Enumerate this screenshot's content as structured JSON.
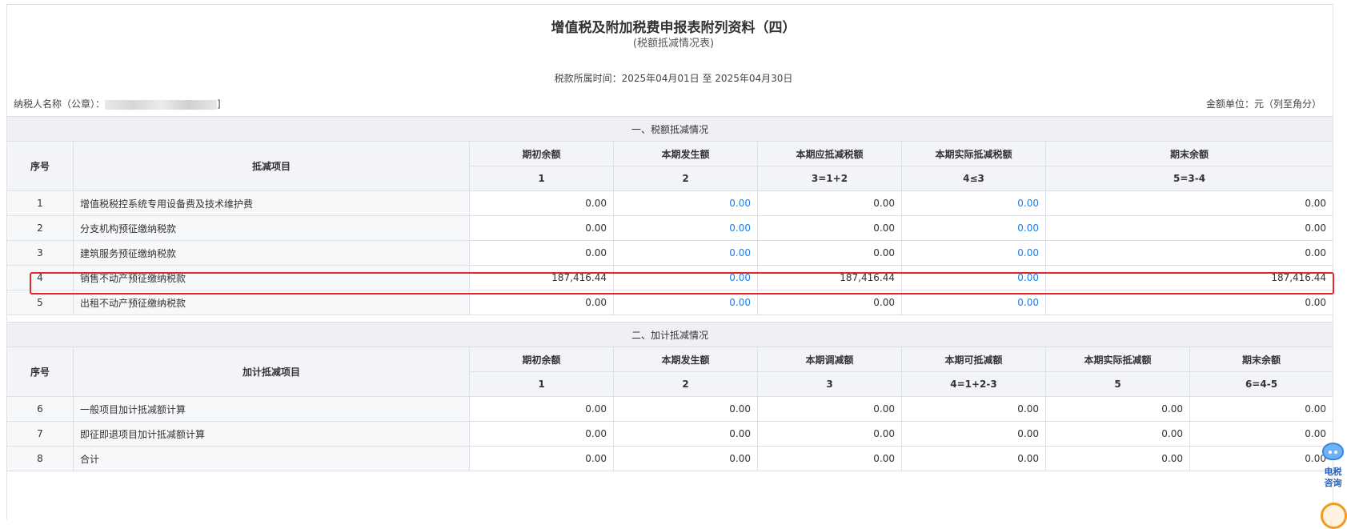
{
  "header": {
    "title": "增值税及附加税费申报表附列资料（四）",
    "subtitle": "(税额抵减情况表)",
    "period": "税款所属时间：2025年04月01日 至 2025年04月30日",
    "taxpayer_label": "纳税人名称（公章）：",
    "taxpayer_suffix": "]",
    "unit": "金额单位：元（列至角分）"
  },
  "section1": {
    "title": "一、税额抵减情况",
    "col_seq": "序号",
    "col_item": "抵减项目",
    "columns": [
      "期初余额",
      "本期发生额",
      "本期应抵减税额",
      "本期实际抵减税额",
      "期末余额"
    ],
    "formulas": [
      "1",
      "2",
      "3=1+2",
      "4≤3",
      "5=3-4"
    ],
    "rows": [
      {
        "seq": "1",
        "item": "增值税税控系统专用设备费及技术维护费",
        "values": [
          "0.00",
          "0.00",
          "0.00",
          "0.00",
          "0.00"
        ]
      },
      {
        "seq": "2",
        "item": "分支机构预征缴纳税款",
        "values": [
          "0.00",
          "0.00",
          "0.00",
          "0.00",
          "0.00"
        ]
      },
      {
        "seq": "3",
        "item": "建筑服务预征缴纳税款",
        "values": [
          "0.00",
          "0.00",
          "0.00",
          "0.00",
          "0.00"
        ]
      },
      {
        "seq": "4",
        "item": "销售不动产预征缴纳税款",
        "values": [
          "187,416.44",
          "0.00",
          "187,416.44",
          "0.00",
          "187,416.44"
        ]
      },
      {
        "seq": "5",
        "item": "出租不动产预征缴纳税款",
        "values": [
          "0.00",
          "0.00",
          "0.00",
          "0.00",
          "0.00"
        ]
      }
    ]
  },
  "section2": {
    "title": "二、加计抵减情况",
    "col_seq": "序号",
    "col_item": "加计抵减项目",
    "columns": [
      "期初余额",
      "本期发生额",
      "本期调减额",
      "本期可抵减额",
      "本期实际抵减额",
      "期末余额"
    ],
    "formulas": [
      "1",
      "2",
      "3",
      "4=1+2-3",
      "5",
      "6=4-5"
    ],
    "rows": [
      {
        "seq": "6",
        "item": "一般项目加计抵减额计算",
        "values": [
          "0.00",
          "0.00",
          "0.00",
          "0.00",
          "0.00",
          "0.00"
        ]
      },
      {
        "seq": "7",
        "item": "即征即退项目加计抵减额计算",
        "values": [
          "0.00",
          "0.00",
          "0.00",
          "0.00",
          "0.00",
          "0.00"
        ]
      },
      {
        "seq": "8",
        "item": "合计",
        "values": [
          "0.00",
          "0.00",
          "0.00",
          "0.00",
          "0.00",
          "0.00"
        ]
      }
    ]
  },
  "assistant": {
    "line1": "电税",
    "line2": "咨询"
  },
  "colors": {
    "link": "#1e7ee8",
    "highlight": "#e8262c"
  }
}
